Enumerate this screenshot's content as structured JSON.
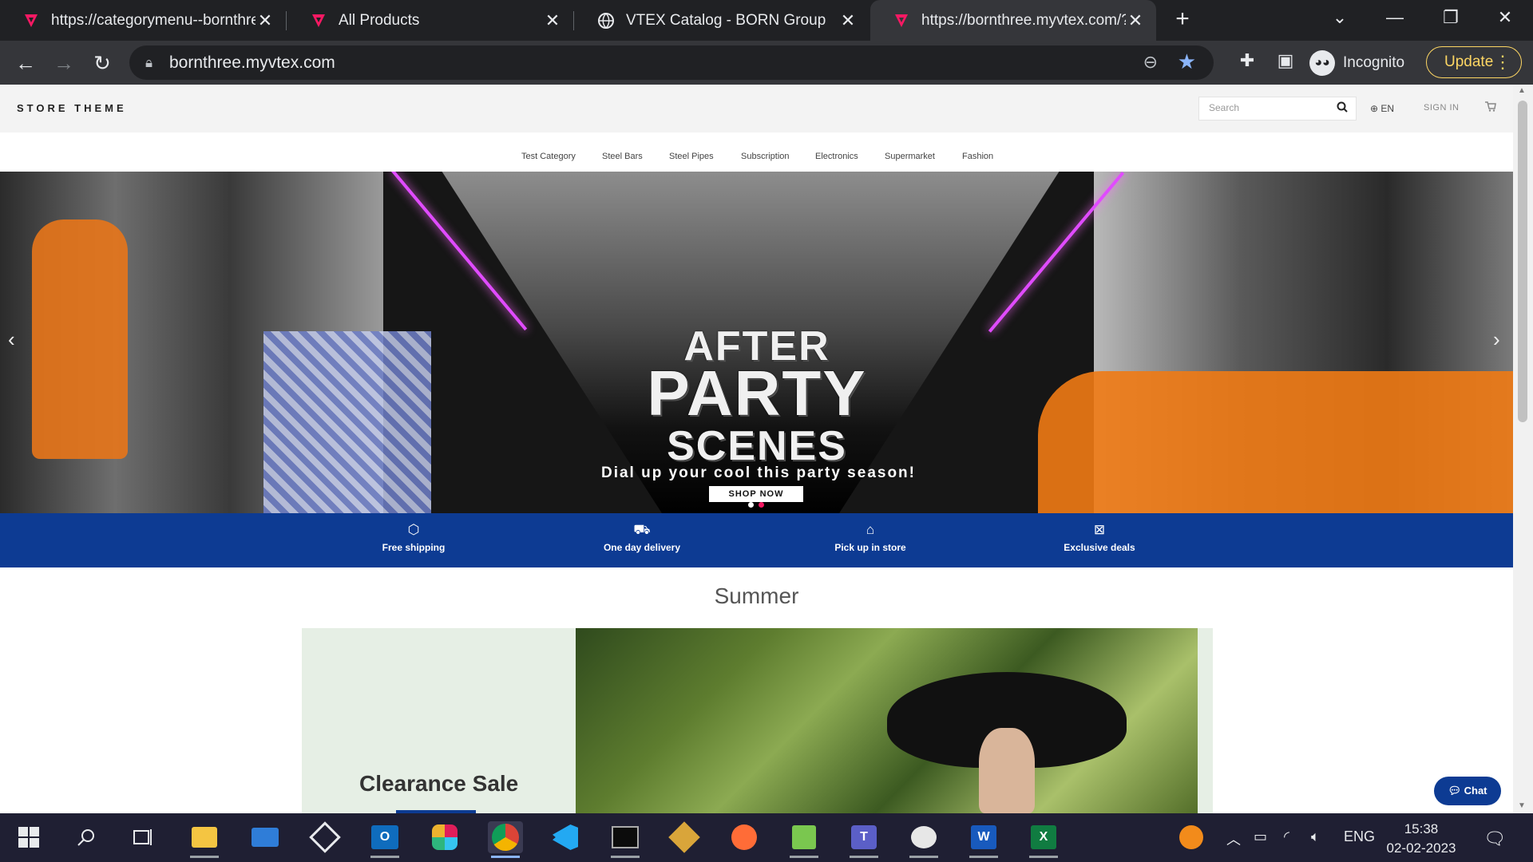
{
  "browser": {
    "tabs": [
      {
        "title": "https://categorymenu--bornthree",
        "favicon": "vtex-icon",
        "active": false
      },
      {
        "title": "All Products",
        "favicon": "vtex-icon",
        "active": false
      },
      {
        "title": "VTEX Catalog - BORN Group",
        "favicon": "globe-icon",
        "active": false
      },
      {
        "title": "https://bornthree.myvtex.com/?",
        "favicon": "vtex-icon",
        "active": true
      }
    ],
    "url": "bornthree.myvtex.com",
    "incognito_label": "Incognito",
    "update_label": "Update"
  },
  "site": {
    "logo": "STORE THEME",
    "search_placeholder": "Search",
    "language": "EN",
    "signin": "SIGN IN",
    "categories": [
      "Test Category",
      "Steel Bars",
      "Steel Pipes",
      "Subscription",
      "Electronics",
      "Supermarket",
      "Fashion"
    ],
    "hero": {
      "line1": "AFTER",
      "line2": "PARTY",
      "line3": "SCENES",
      "tagline": "Dial up your cool this party season!",
      "cta": "SHOP NOW"
    },
    "benefits": [
      {
        "label": "Free shipping",
        "icon": "box-icon"
      },
      {
        "label": "One day delivery",
        "icon": "truck-icon"
      },
      {
        "label": "Pick up in store",
        "icon": "store-icon"
      },
      {
        "label": "Exclusive deals",
        "icon": "ticket-icon"
      }
    ],
    "section_title": "Summer",
    "promo_title": "Clearance Sale",
    "chat_label": "Chat"
  },
  "taskbar": {
    "language": "ENG",
    "time": "15:38",
    "date": "02-02-2023"
  },
  "colors": {
    "brand_blue": "#0d3b93",
    "vtex_pink": "#f71963",
    "chrome_update": "#fdd663"
  }
}
